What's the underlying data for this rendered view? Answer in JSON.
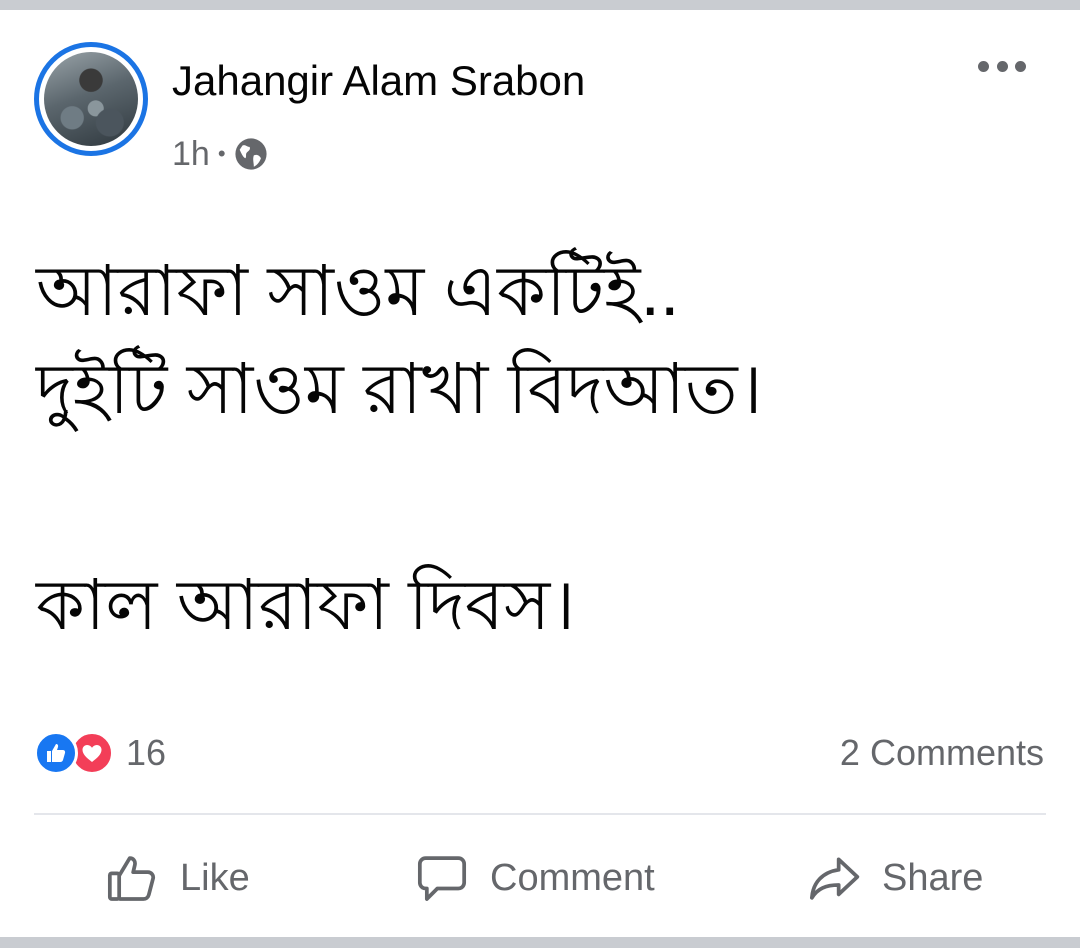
{
  "post": {
    "author": "Jahangir Alam Srabon",
    "time": "1h",
    "separator": "•",
    "privacy_icon": "globe-icon",
    "menu_icon": "more-options-icon",
    "text_lines": [
      "আরাফা সাওম একটিই..",
      "দুইটি সাওম রাখা বিদআত।",
      "",
      "কাল আরাফা দিবস।"
    ]
  },
  "reactions": {
    "icons": [
      "like-reaction-icon",
      "love-reaction-icon"
    ],
    "count": "16",
    "comments": "2 Comments"
  },
  "actions": {
    "like_label": "Like",
    "comment_label": "Comment",
    "share_label": "Share"
  },
  "colors": {
    "accent": "#1877f2",
    "love": "#f33e58",
    "secondary_text": "#65676b",
    "separator": "#c9ccd1"
  }
}
